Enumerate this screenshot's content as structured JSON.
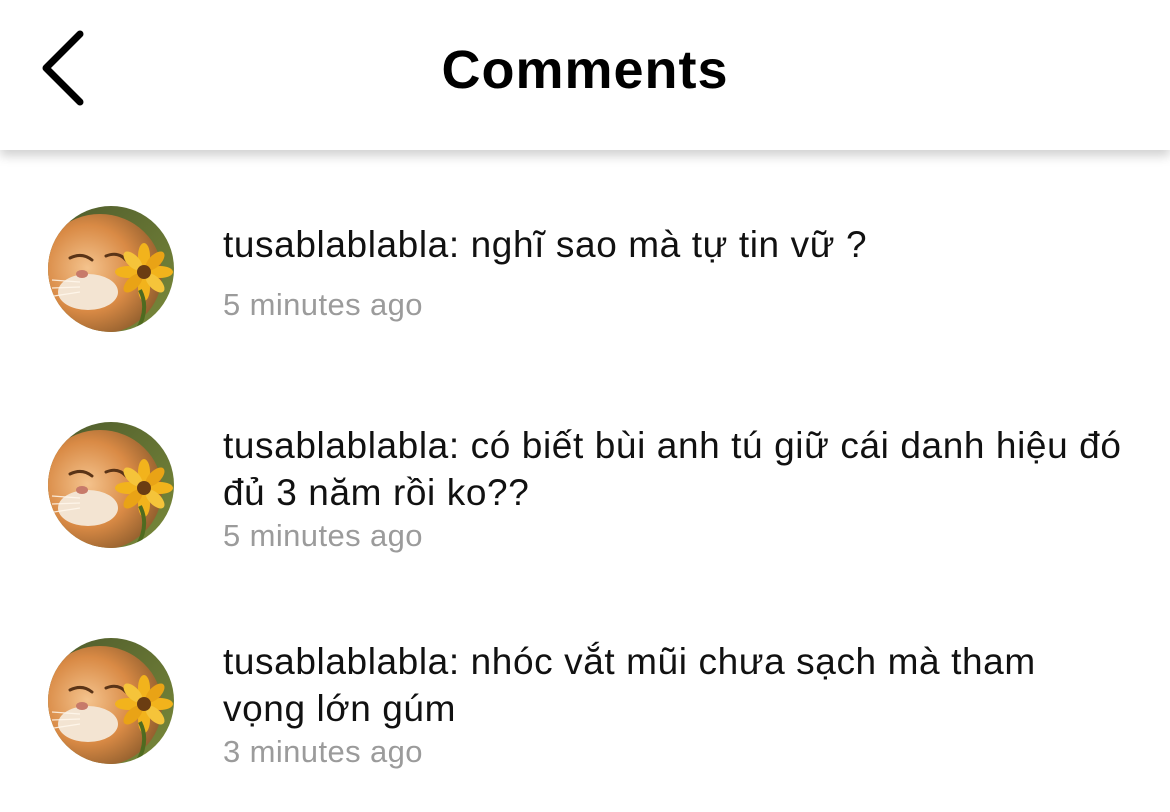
{
  "header": {
    "title": "Comments",
    "back_icon": "chevron-left-icon"
  },
  "comments": [
    {
      "username": "tusablablabla",
      "text": "tusablablabla: nghĩ sao mà tự tin vữ ?",
      "time": "5 minutes ago",
      "avatar": "cat-with-flower-avatar"
    },
    {
      "username": "tusablablabla",
      "text": "tusablablabla: có biết bùi anh tú giữ cái danh hiệu đó đủ 3 năm rồi ko??",
      "time": "5 minutes ago",
      "avatar": "cat-with-flower-avatar"
    },
    {
      "username": "tusablablabla",
      "text": "tusablablabla: nhóc vắt mũi chưa sạch mà tham vọng lớn gúm",
      "time": "3 minutes ago",
      "avatar": "cat-with-flower-avatar"
    }
  ],
  "colors": {
    "text": "#111111",
    "timestamp": "#9b9b9b",
    "background": "#ffffff"
  }
}
